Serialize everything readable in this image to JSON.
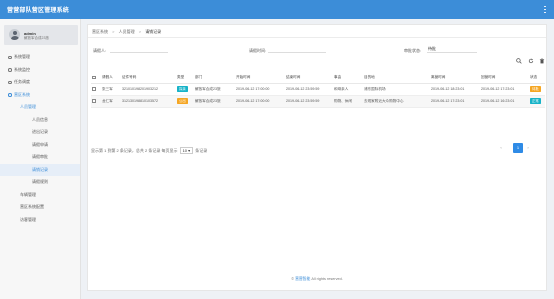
{
  "app": {
    "title": "营营部队营区管理系统"
  },
  "user": {
    "name": "admin",
    "org": "解放军合成23旅"
  },
  "sidebar": {
    "items": [
      {
        "label": "系统管理",
        "level": 1,
        "active": false
      },
      {
        "label": "系统监控",
        "level": 1,
        "active": false
      },
      {
        "label": "任务调度",
        "level": 1,
        "active": false
      },
      {
        "label": "营区系统",
        "level": 1,
        "active": true
      },
      {
        "label": "人员管理",
        "level": 2,
        "active": true
      },
      {
        "label": "人员信息",
        "level": 3,
        "active": false
      },
      {
        "label": "进出记录",
        "level": 3,
        "active": false
      },
      {
        "label": "请假申请",
        "level": 3,
        "active": false
      },
      {
        "label": "请假审批",
        "level": 3,
        "active": false
      },
      {
        "label": "请销记录",
        "level": 3,
        "active": true
      },
      {
        "label": "请假规则",
        "level": 3,
        "active": false
      },
      {
        "label": "车辆管理",
        "level": 2,
        "active": false
      },
      {
        "label": "营区系统配置",
        "level": 2,
        "active": false
      },
      {
        "label": "访客管理",
        "level": 2,
        "active": false
      }
    ]
  },
  "breadcrumb": {
    "items": [
      "营区系统",
      "人员管理",
      "请销记录"
    ],
    "sep": ">"
  },
  "filters": {
    "person_label": "请假人:",
    "person_value": "",
    "time_label": "请假时间:",
    "time_value": "",
    "status_label": "审批状态:",
    "status_value": "待批"
  },
  "table": {
    "headers": [
      "",
      "请假人",
      "证件号码",
      "类型",
      "部门",
      "开始时间",
      "结束时间",
      "事由",
      "目的地",
      "离营时间",
      "回营时间",
      "状态"
    ],
    "rows": [
      {
        "name": "张三军",
        "id": "321010198201903212",
        "type": "探亲",
        "type_color": "#17b3c8",
        "dept": "解放军合成23旅",
        "start": "2019-06-12 17:00:00",
        "end": "2019-06-12 23:59:59",
        "reason": "和母亲人",
        "dest": "浦东国际机场",
        "leave": "2019-06-12 18:23:01",
        "return": "2019-06-12 17:23:01",
        "status": "待批",
        "status_color": "#f5a623"
      },
      {
        "name": "龙仁军",
        "id": "312130198810103572",
        "type": "公出",
        "type_color": "#f5a623",
        "dept": "解放军合成23旅",
        "start": "2019-06-12 17:00:00",
        "end": "2019-06-12 23:59:59",
        "reason": "购物、休闲",
        "dest": "去现家附近大众购物中心",
        "leave": "2019-06-12 17:23:01",
        "return": "2019-06-12 16:23:01",
        "status": "正常",
        "status_color": "#17b3c8"
      }
    ]
  },
  "pagination": {
    "info_before": "显示第 1 到第 2 条记录，总共 2 条记录 每页显示",
    "page_size": "10 ▾",
    "info_after": "条记录",
    "prev": "‹",
    "current": "1",
    "next": "›"
  },
  "footer": {
    "brand": "营营智能",
    "rights": "All rights reserved."
  },
  "colors": {
    "primary": "#3c8dd8",
    "warning": "#f5a623",
    "info": "#17b3c8"
  }
}
